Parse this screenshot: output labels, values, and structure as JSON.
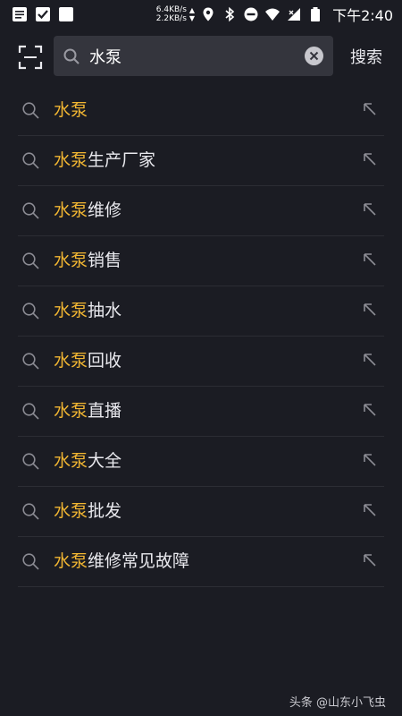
{
  "status_bar": {
    "net_speed_up": "6.4KB/s",
    "net_speed_down": "2.2KB/s",
    "time": "下午2:40",
    "left_icons": [
      "notification-icon",
      "checkmark-app-icon",
      "blank-app-icon"
    ],
    "right_icons": [
      "location-icon",
      "bluetooth-icon",
      "do-not-disturb-icon",
      "wifi-icon",
      "signal-icon",
      "battery-icon"
    ]
  },
  "search": {
    "query": "水泵",
    "action_label": "搜索"
  },
  "suggestions": [
    {
      "highlight": "水泵",
      "rest": ""
    },
    {
      "highlight": "水泵",
      "rest": "生产厂家"
    },
    {
      "highlight": "水泵",
      "rest": "维修"
    },
    {
      "highlight": "水泵",
      "rest": "销售"
    },
    {
      "highlight": "水泵",
      "rest": "抽水"
    },
    {
      "highlight": "水泵",
      "rest": "回收"
    },
    {
      "highlight": "水泵",
      "rest": "直播"
    },
    {
      "highlight": "水泵",
      "rest": "大全"
    },
    {
      "highlight": "水泵",
      "rest": "批发"
    },
    {
      "highlight": "水泵",
      "rest": "维修常见故障"
    }
  ],
  "watermark": "头条 @山东小飞虫",
  "colors": {
    "background": "#1b1c23",
    "highlight": "#f2b632",
    "search_box": "#34353d"
  }
}
